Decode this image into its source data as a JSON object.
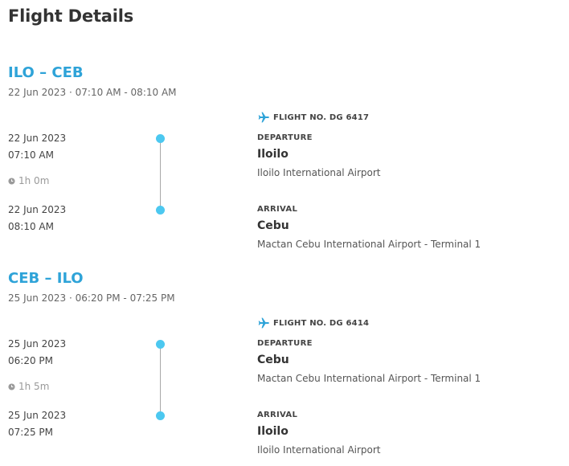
{
  "page": {
    "title": "Flight Details"
  },
  "colors": {
    "route_accent": "#2ea3d8",
    "timeline_dot": "#4cc8f0"
  },
  "segments": [
    {
      "route": "ILO – CEB",
      "summary": "22 Jun 2023 · 07:10 AM - 08:10 AM",
      "flight_no": "FLIGHT NO. DG 6417",
      "departure": {
        "date": "22 Jun 2023",
        "time": "07:10 AM",
        "label": "DEPARTURE",
        "city": "Iloilo",
        "airport": "Iloilo International Airport"
      },
      "duration": "1h 0m",
      "arrival": {
        "date": "22 Jun 2023",
        "time": "08:10 AM",
        "label": "ARRIVAL",
        "city": "Cebu",
        "airport": "Mactan Cebu International Airport - Terminal 1"
      }
    },
    {
      "route": "CEB – ILO",
      "summary": "25 Jun 2023 · 06:20 PM - 07:25 PM",
      "flight_no": "FLIGHT NO. DG 6414",
      "departure": {
        "date": "25 Jun 2023",
        "time": "06:20 PM",
        "label": "DEPARTURE",
        "city": "Cebu",
        "airport": "Mactan Cebu International Airport - Terminal 1"
      },
      "duration": "1h 5m",
      "arrival": {
        "date": "25 Jun 2023",
        "time": "07:25 PM",
        "label": "ARRIVAL",
        "city": "Iloilo",
        "airport": "Iloilo International Airport"
      }
    }
  ]
}
